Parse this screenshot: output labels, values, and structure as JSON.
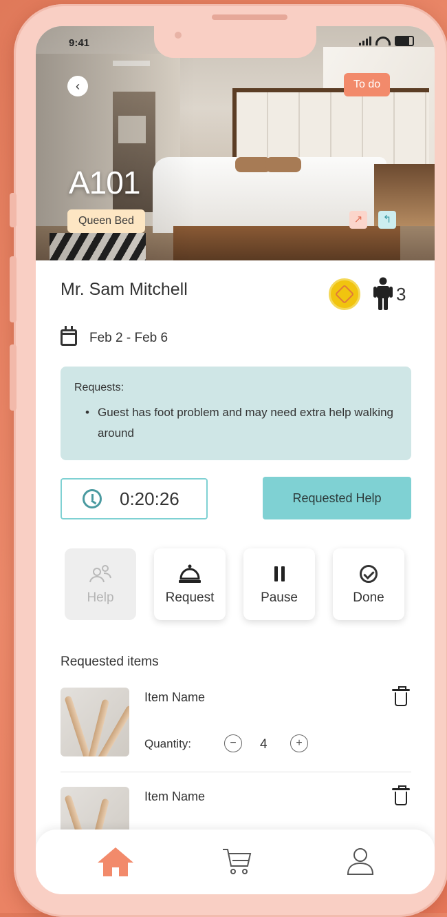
{
  "status_bar": {
    "time": "9:41"
  },
  "room": {
    "number": "A101",
    "bed_type": "Queen Bed",
    "status_badge": "To do",
    "back_icon": "chevron-left-icon"
  },
  "guest": {
    "name": "Mr. Sam Mitchell",
    "guest_count": "3",
    "dates": "Feb 2 - Feb 6"
  },
  "requests": {
    "title": "Requests:",
    "items": [
      "Guest has foot problem and may need extra help walking around"
    ]
  },
  "timer": {
    "value": "0:20:26"
  },
  "requested_help_label": "Requested Help",
  "actions": [
    {
      "label": "Help",
      "icon": "people-icon",
      "enabled": false
    },
    {
      "label": "Request",
      "icon": "bell-icon",
      "enabled": true
    },
    {
      "label": "Pause",
      "icon": "pause-icon",
      "enabled": true
    },
    {
      "label": "Done",
      "icon": "check-circle-icon",
      "enabled": true
    }
  ],
  "requested_items": {
    "title": "Requested items",
    "quantity_label": "Quantity:",
    "items": [
      {
        "name": "Item Name",
        "quantity": "4"
      },
      {
        "name": "Item Name"
      }
    ]
  },
  "nav": [
    {
      "icon": "home-icon",
      "active": true
    },
    {
      "icon": "cart-icon",
      "active": false
    },
    {
      "icon": "profile-icon",
      "active": false
    }
  ],
  "colors": {
    "accent": "#f28a6b",
    "teal": "#7fd1d3",
    "requests_bg": "#cfe6e6",
    "bed_badge_bg": "#fde6c3",
    "vip_gold": "#f1c40f"
  }
}
